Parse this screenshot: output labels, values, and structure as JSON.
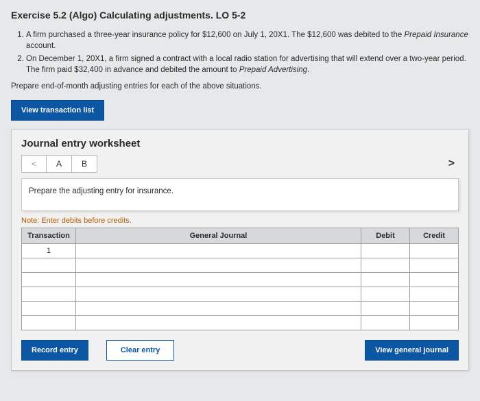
{
  "title": "Exercise 5.2 (Algo) Calculating adjustments. LO 5-2",
  "items": [
    {
      "pre": "A firm purchased a three-year insurance policy for $12,600 on July 1, 20X1. The $12,600 was debited to the ",
      "em": "Prepaid Insurance",
      "post": " account."
    },
    {
      "pre": "On December 1, 20X1, a firm signed a contract with a local radio station for advertising that will extend over a two-year period. The firm paid $32,400 in advance and debited the amount to ",
      "em": "Prepaid Advertising",
      "post": "."
    }
  ],
  "instruction": "Prepare end-of-month adjusting entries for each of the above situations.",
  "view_txn_list": "View transaction list",
  "ws_title": "Journal entry worksheet",
  "tabs": {
    "prev": "<",
    "a": "A",
    "b": "B",
    "next": ">"
  },
  "prompt": "Prepare the adjusting entry for insurance.",
  "note": "Note: Enter debits before credits.",
  "table": {
    "h_transaction": "Transaction",
    "h_general": "General Journal",
    "h_debit": "Debit",
    "h_credit": "Credit",
    "first_txn": "1"
  },
  "actions": {
    "record": "Record entry",
    "clear": "Clear entry",
    "view_gj": "View general journal"
  }
}
